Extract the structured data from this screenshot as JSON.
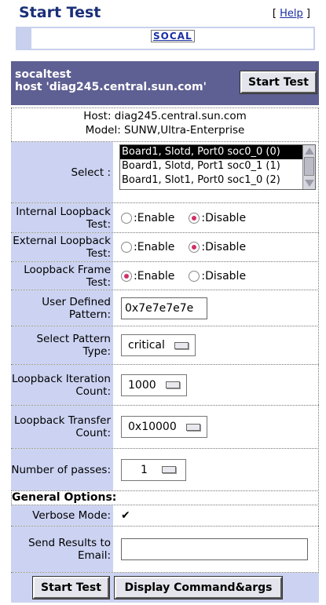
{
  "page": {
    "title": "Start Test",
    "help_open": "[ ",
    "help_label": "Help",
    "help_close": " ]",
    "nav_label": "SOCAL"
  },
  "header": {
    "test_name": "socaltest",
    "host_line": "host 'diag245.central.sun.com'",
    "start_button": "Start Test"
  },
  "host_info": {
    "host": "Host: diag245.central.sun.com",
    "model": "Model: SUNW,Ultra-Enterprise"
  },
  "form": {
    "select": {
      "label": "Select :",
      "options": [
        "Board1, Slotd, Port0 soc0_0 (0)",
        "Board1, Slotd, Port1 soc0_1 (1)",
        "Board1, Slot1, Port0 soc1_0 (2)"
      ],
      "selected_index": 0
    },
    "internal_loopback": {
      "label": "Internal Loopback Test:",
      "enable": ":Enable",
      "disable": ":Disable",
      "value": "Disable"
    },
    "external_loopback": {
      "label": "External Loopback Test:",
      "enable": ":Enable",
      "disable": ":Disable",
      "value": "Disable"
    },
    "loopback_frame": {
      "label": "Loopback Frame Test:",
      "enable": ":Enable",
      "disable": ":Disable",
      "value": "Enable"
    },
    "user_pattern": {
      "label": "User Defined Pattern:",
      "value": "0x7e7e7e7e"
    },
    "pattern_type": {
      "label": "Select Pattern Type:",
      "value": "critical"
    },
    "iteration_count": {
      "label": "Loopback Iteration Count:",
      "value": "1000"
    },
    "transfer_count": {
      "label": "Loopback Transfer Count:",
      "value": "0x10000"
    },
    "passes": {
      "label": "Number of passes:",
      "value": "1"
    }
  },
  "general": {
    "heading": "General Options:",
    "verbose": {
      "label": "Verbose Mode:",
      "checked": true
    },
    "email": {
      "label": "Send Results to Email:",
      "value": ""
    }
  },
  "footer": {
    "start_button": "Start Test",
    "display_button": "Display Command&args"
  },
  "colors": {
    "title": "#1b2f78",
    "link": "#1a2ea4",
    "header_bg": "#5e5f92",
    "label_bg": "#ccd3f2",
    "radio_dot": "#d0306a"
  }
}
